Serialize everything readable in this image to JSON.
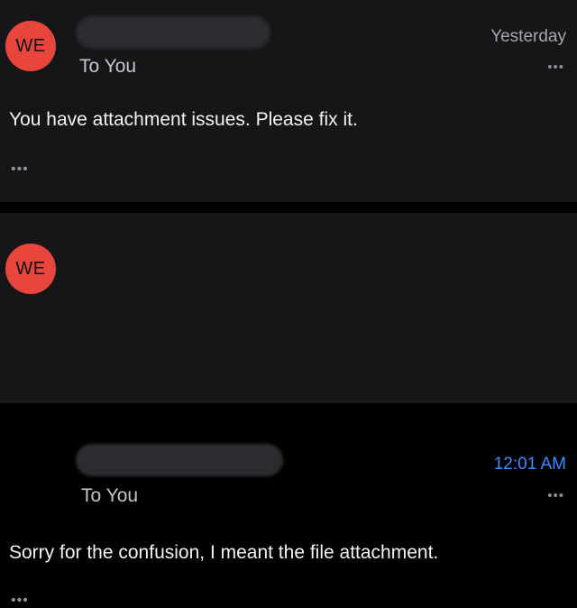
{
  "colors": {
    "avatar_bg": "#e8453c",
    "timestamp_read": "#a6a6ab",
    "timestamp_unread": "#3b8cff",
    "card_bg": "#161618"
  },
  "messages": [
    {
      "avatar_initials": "WE",
      "recipient": "To You",
      "timestamp": "Yesterday",
      "body": "You have attachment issues. Please fix it.",
      "more_icon": "ellipsis-icon"
    },
    {
      "avatar_initials": "WE",
      "recipient": "To You",
      "timestamp": "12:01 AM",
      "body": "Sorry for the confusion, I meant the file attachment.",
      "more_icon": "ellipsis-icon"
    }
  ]
}
